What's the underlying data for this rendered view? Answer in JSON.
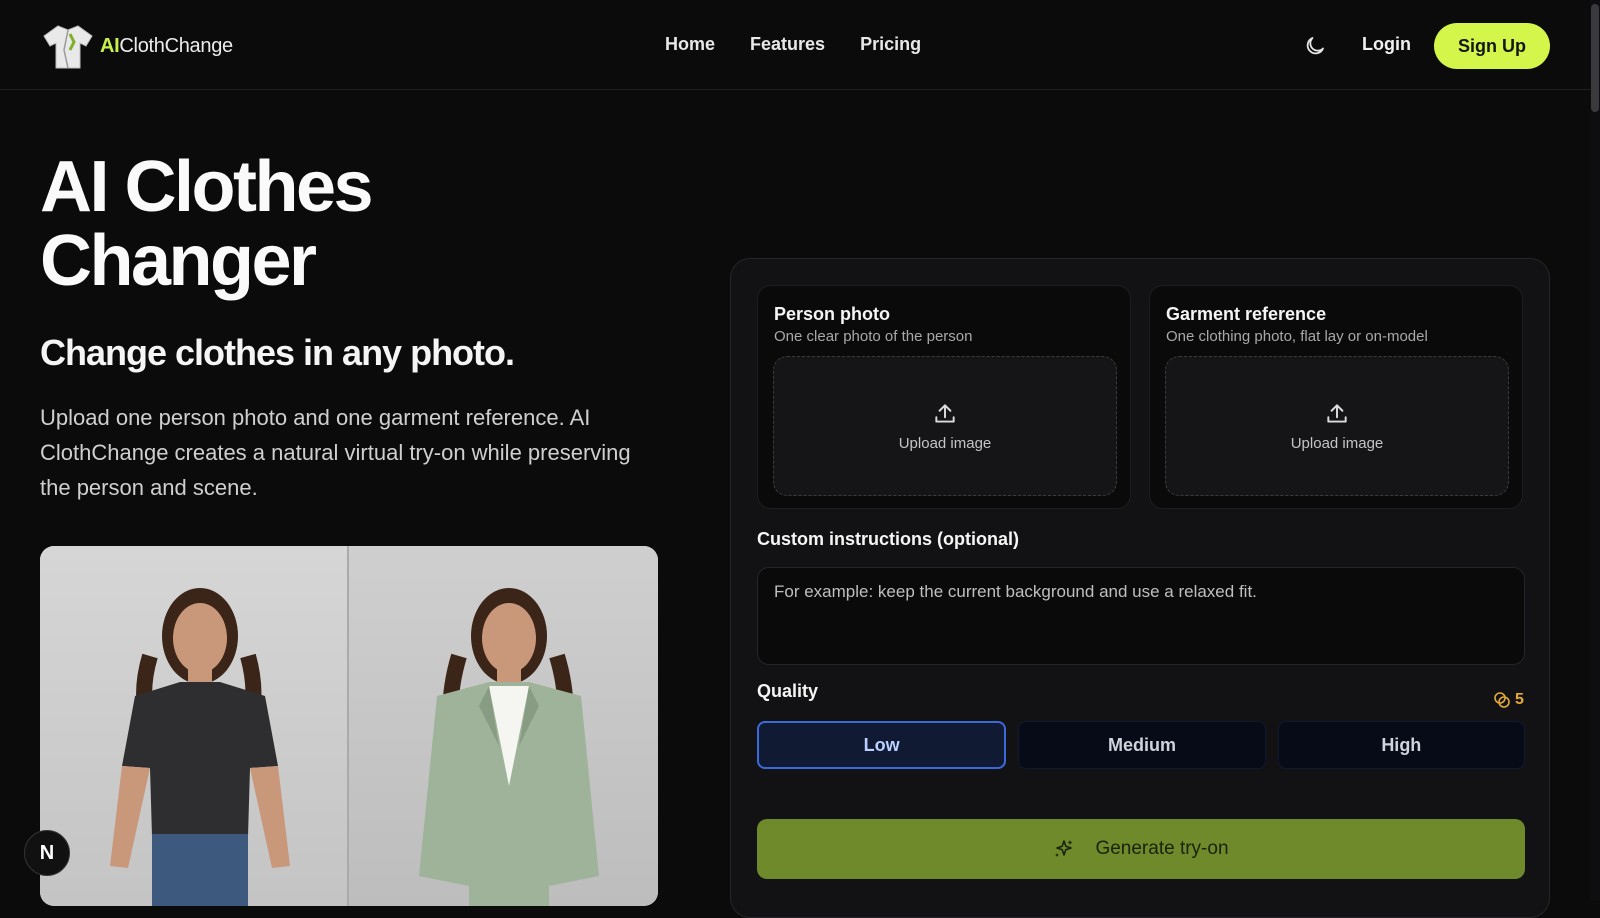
{
  "header": {
    "logo_ai": "AI",
    "logo_rest": "ClothChange",
    "nav": [
      "Home",
      "Features",
      "Pricing"
    ],
    "login": "Login",
    "signup": "Sign Up"
  },
  "hero": {
    "title_line1": "AI Clothes",
    "title_line2": "Changer",
    "subtitle": "Change clothes in any photo.",
    "description": "Upload one person photo and one garment reference. AI ClothChange creates a natural virtual try-on while preserving the person and scene."
  },
  "badge": "N",
  "uploads": {
    "person": {
      "title": "Person photo",
      "hint": "One clear photo of the person",
      "action": "Upload image"
    },
    "garment": {
      "title": "Garment reference",
      "hint": "One clothing photo, flat lay or on-model",
      "action": "Upload image"
    }
  },
  "instructions": {
    "label": "Custom instructions (optional)",
    "placeholder": "For example: keep the current background and use a relaxed fit."
  },
  "quality": {
    "label": "Quality",
    "credits": "5",
    "options": [
      "Low",
      "Medium",
      "High"
    ],
    "selected": "Low"
  },
  "generate_label": "Generate try-on",
  "colors": {
    "accent": "#d4f54a",
    "generate": "#6e8a2a",
    "selected_border": "#3b6ad8",
    "credit": "#e5a937"
  }
}
